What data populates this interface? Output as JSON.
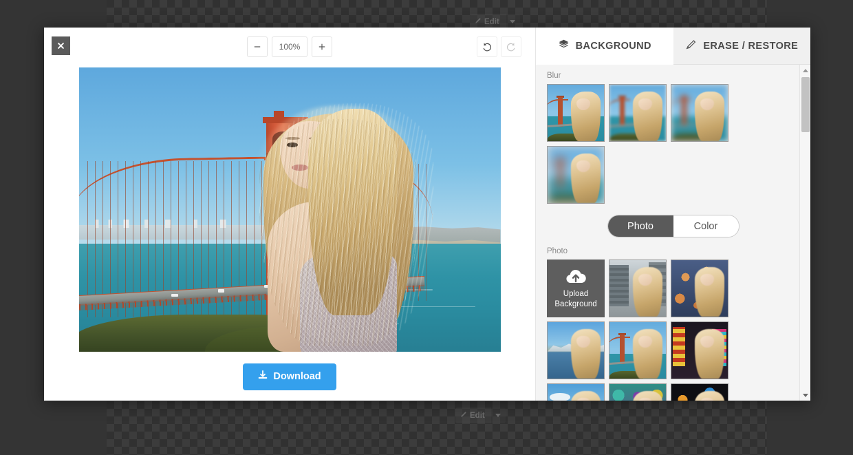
{
  "behind": {
    "edit_label": "Edit",
    "edit_icon": "brush-icon",
    "caret_icon": "chevron-down-icon"
  },
  "editor": {
    "close_icon": "close-icon",
    "zoom_out_label": "−",
    "zoom_level": "100%",
    "zoom_in_label": "+",
    "undo_icon": "undo-icon",
    "redo_icon": "redo-icon",
    "download_label": "Download",
    "download_icon": "download-icon",
    "accent_color": "#34a0ed"
  },
  "panel": {
    "tabs": [
      {
        "label": "BACKGROUND",
        "icon": "layers-icon",
        "active": true
      },
      {
        "label": "ERASE / RESTORE",
        "icon": "brush-icon",
        "active": false
      }
    ],
    "blur_section_label": "Blur",
    "blur_options": [
      {
        "name": "blur-none"
      },
      {
        "name": "blur-low"
      },
      {
        "name": "blur-medium"
      },
      {
        "name": "blur-high"
      }
    ],
    "toggle": {
      "photo_label": "Photo",
      "color_label": "Color",
      "selected": "Photo"
    },
    "photo_section_label": "Photo",
    "upload": {
      "icon": "cloud-upload-icon",
      "line1": "Upload",
      "line2": "Background"
    },
    "photo_options": [
      {
        "name": "city-street"
      },
      {
        "name": "warm-bokeh"
      },
      {
        "name": "mountain-lake"
      },
      {
        "name": "golden-gate"
      },
      {
        "name": "neon-street"
      },
      {
        "name": "sky-mountain"
      },
      {
        "name": "color-dots"
      },
      {
        "name": "dark-bokeh"
      }
    ],
    "scrollbar": {
      "up_icon": "scroll-up-arrow",
      "down_icon": "scroll-down-arrow"
    }
  }
}
